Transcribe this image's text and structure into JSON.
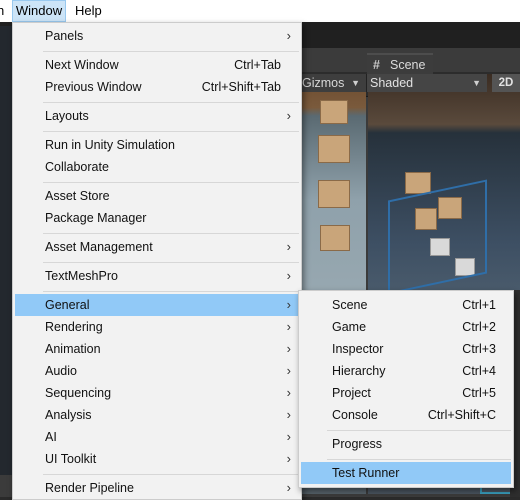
{
  "menubar": {
    "partial_left": "n",
    "items": [
      "Window",
      "Help"
    ]
  },
  "editor": {
    "scene_tab": "Scene",
    "gizmos": "Gizmos",
    "shading_mode": "Shaded",
    "mode_2d": "2D"
  },
  "window_menu": {
    "items": [
      {
        "label": "Panels",
        "submenu": true
      },
      {
        "label": "Next Window",
        "shortcut": "Ctrl+Tab"
      },
      {
        "label": "Previous Window",
        "shortcut": "Ctrl+Shift+Tab"
      },
      {
        "label": "Layouts",
        "submenu": true
      },
      {
        "label": "Run in Unity Simulation"
      },
      {
        "label": "Collaborate"
      },
      {
        "label": "Asset Store"
      },
      {
        "label": "Package Manager"
      },
      {
        "label": "Asset Management",
        "submenu": true
      },
      {
        "label": "TextMeshPro",
        "submenu": true
      },
      {
        "label": "General",
        "submenu": true,
        "highlighted": true
      },
      {
        "label": "Rendering",
        "submenu": true
      },
      {
        "label": "Animation",
        "submenu": true
      },
      {
        "label": "Audio",
        "submenu": true
      },
      {
        "label": "Sequencing",
        "submenu": true
      },
      {
        "label": "Analysis",
        "submenu": true
      },
      {
        "label": "AI",
        "submenu": true
      },
      {
        "label": "UI Toolkit",
        "submenu": true
      },
      {
        "label": "Render Pipeline",
        "submenu": true
      }
    ]
  },
  "general_submenu": {
    "items": [
      {
        "label": "Scene",
        "shortcut": "Ctrl+1"
      },
      {
        "label": "Game",
        "shortcut": "Ctrl+2"
      },
      {
        "label": "Inspector",
        "shortcut": "Ctrl+3"
      },
      {
        "label": "Hierarchy",
        "shortcut": "Ctrl+4"
      },
      {
        "label": "Project",
        "shortcut": "Ctrl+5"
      },
      {
        "label": "Console",
        "shortcut": "Ctrl+Shift+C"
      },
      {
        "label": "Progress"
      },
      {
        "label": "Test Runner",
        "highlighted": true
      }
    ]
  },
  "icons": {
    "submenu_arrow": "chevron-right-icon",
    "dropdown_arrow": "caret-down-icon",
    "scene_tab_icon": "hash-icon"
  },
  "colors": {
    "menu_bg": "#f2f2f2",
    "menu_highlight": "#91c9f7",
    "menubar_active": "#cce4f7"
  }
}
